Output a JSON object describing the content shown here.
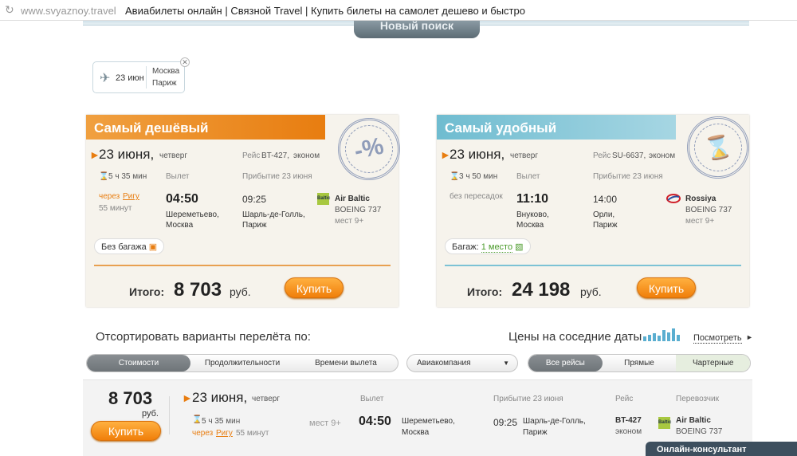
{
  "browser": {
    "url": "www.svyaznoy.travel",
    "title": "Авиабилеты онлайн | Связной Travel | Купить билеты на самолет дешево и быстро"
  },
  "search": {
    "new_search_label": "Новый поиск",
    "chip": {
      "date": "23 июн",
      "from": "Москва",
      "to": "Париж"
    }
  },
  "cheapest": {
    "header": "Самый дешёвый",
    "date": "23 июня,",
    "weekday": "четверг",
    "flight_label": "Рейс",
    "flight": "BT-427,",
    "class": "эконом",
    "duration": "5 ч 35 мин",
    "departure_label": "Вылет",
    "arrival_label": "Прибытие 23 июня",
    "via_prefix": "через",
    "via_city": "Ригу",
    "layover": "55 минут",
    "dep_time": "04:50",
    "dep_airport": "Шереметьево,",
    "dep_city": "Москва",
    "arr_time": "09:25",
    "arr_airport": "Шарль-де-Голль,",
    "arr_city": "Париж",
    "airline": "Air Baltic",
    "aircraft": "BOEING 737",
    "seats": "мест 9+",
    "baggage": "Без багажа",
    "total_label": "Итого:",
    "total": "8 703",
    "currency": "руб.",
    "buy": "Купить",
    "stamp": "-%"
  },
  "convenient": {
    "header": "Самый удобный",
    "date": "23 июня,",
    "weekday": "четверг",
    "flight_label": "Рейс",
    "flight": "SU-6637,",
    "class": "эконом",
    "duration": "3 ч 50 мин",
    "departure_label": "Вылет",
    "arrival_label": "Прибытие 23 июня",
    "stops": "без пересадок",
    "dep_time": "11:10",
    "dep_airport": "Внуково,",
    "dep_city": "Москва",
    "arr_time": "14:00",
    "arr_airport": "Орли,",
    "arr_city": "Париж",
    "airline": "Rossiya",
    "aircraft": "BOEING 737",
    "seats": "мест 9+",
    "baggage_label": "Багаж:",
    "baggage": "1 место",
    "total_label": "Итого:",
    "total": "24 198",
    "currency": "руб.",
    "buy": "Купить"
  },
  "sorting": {
    "label": "Отсортировать варианты перелёта по:",
    "options": [
      "Стоимости",
      "Продолжительности",
      "Времени вылета"
    ],
    "airline_select": "Авиакомпания",
    "flight_filter": [
      "Все рейсы",
      "Прямые",
      "Чартерные"
    ]
  },
  "nearby": {
    "label": "Цены на соседние даты",
    "link": "Посмотреть"
  },
  "result": {
    "price": "8 703",
    "currency": "руб.",
    "buy": "Купить",
    "date": "23 июня,",
    "weekday": "четверг",
    "departure_label": "Вылет",
    "arrival_label": "Прибытие 23 июня",
    "flight_label": "Рейс",
    "carrier_label": "Перевозчик",
    "duration": "5 ч 35 мин",
    "via_prefix": "через",
    "via_city": "Ригу",
    "layover": "55 минут",
    "seats": "мест 9+",
    "dep_time": "04:50",
    "dep_airport": "Шереметьево,",
    "dep_city": "Москва",
    "arr_time": "09:25",
    "arr_airport": "Шарль-де-Голль,",
    "arr_city": "Париж",
    "flight": "BT-427",
    "class": "эконом",
    "airline": "Air Baltic",
    "aircraft": "BOEING 737"
  },
  "consultant": "Онлайн-консультант",
  "colors": {
    "accent_orange": "#e87d10",
    "accent_blue": "#6fbcd0",
    "ok_green": "#4a9a2a"
  }
}
